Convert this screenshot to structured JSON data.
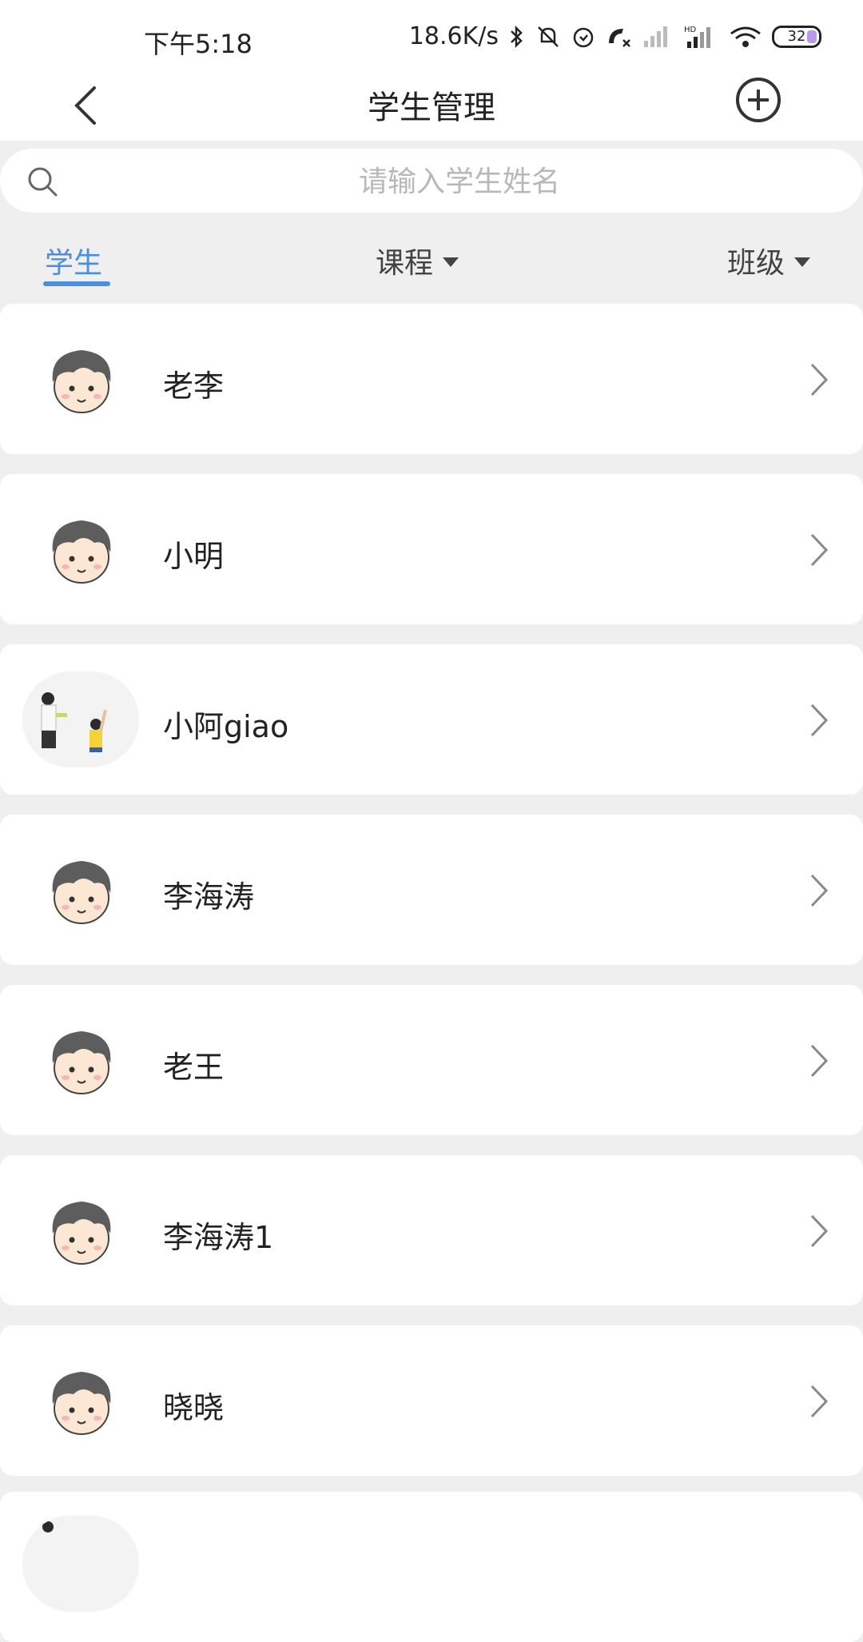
{
  "status": {
    "time": "下午5:18",
    "network_speed": "18.6K/s",
    "battery": "32"
  },
  "header": {
    "title": "学生管理"
  },
  "search": {
    "placeholder": "请输入学生姓名"
  },
  "filters": {
    "students": "学生",
    "course": "课程",
    "class": "班级"
  },
  "students": [
    {
      "name": "老李",
      "avatar": "cartoon-boy"
    },
    {
      "name": "小明",
      "avatar": "cartoon-boy"
    },
    {
      "name": "小阿giao",
      "avatar": "teacher-photo"
    },
    {
      "name": "李海涛",
      "avatar": "cartoon-boy"
    },
    {
      "name": "老王",
      "avatar": "cartoon-boy"
    },
    {
      "name": "李海涛1",
      "avatar": "cartoon-boy"
    },
    {
      "name": "晓晓",
      "avatar": "cartoon-boy"
    }
  ],
  "colors": {
    "accent": "#4a8ee0",
    "background": "#efefef"
  }
}
